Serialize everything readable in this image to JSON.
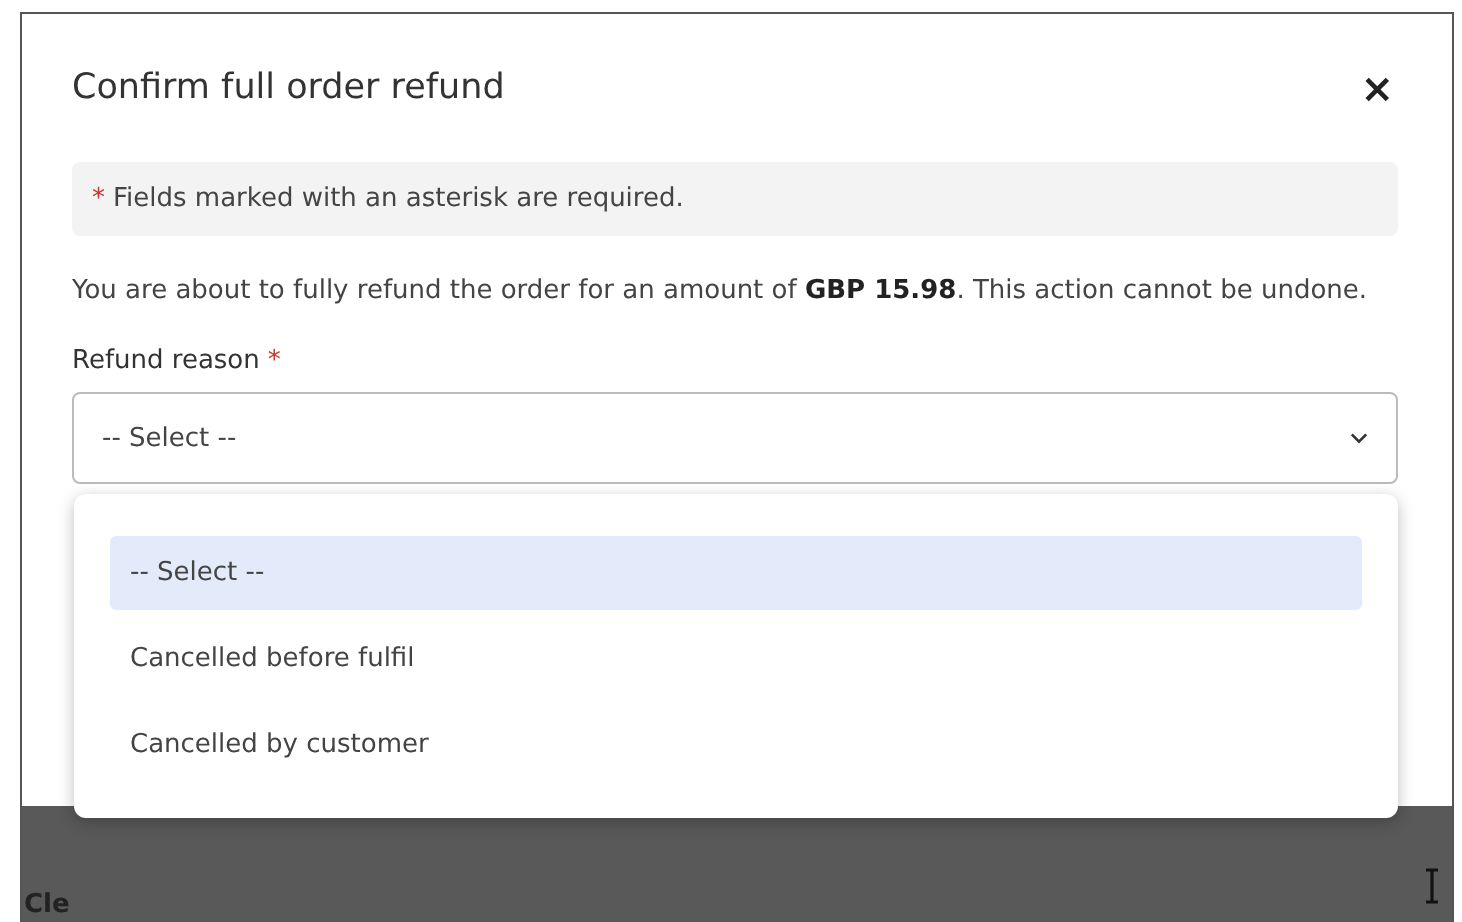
{
  "dialog": {
    "title": "Confirm full order refund",
    "close": "×",
    "notice": {
      "marker": "*",
      "text": "Fields marked with an asterisk are required."
    },
    "message": "You are about to fully refund the order for an amount of **GBP 15.98**. This action cannot be undone.",
    "field": {
      "label": "Refund reason",
      "required_mark": "*",
      "value": "-- Select --",
      "expanded": true,
      "options": [
        {
          "label": "-- Select --",
          "selected": true
        },
        {
          "label": "Cancelled before fulfil",
          "selected": false
        },
        {
          "label": "Cancelled by customer",
          "selected": false
        }
      ]
    }
  },
  "footer": {
    "text": "Cle"
  }
}
